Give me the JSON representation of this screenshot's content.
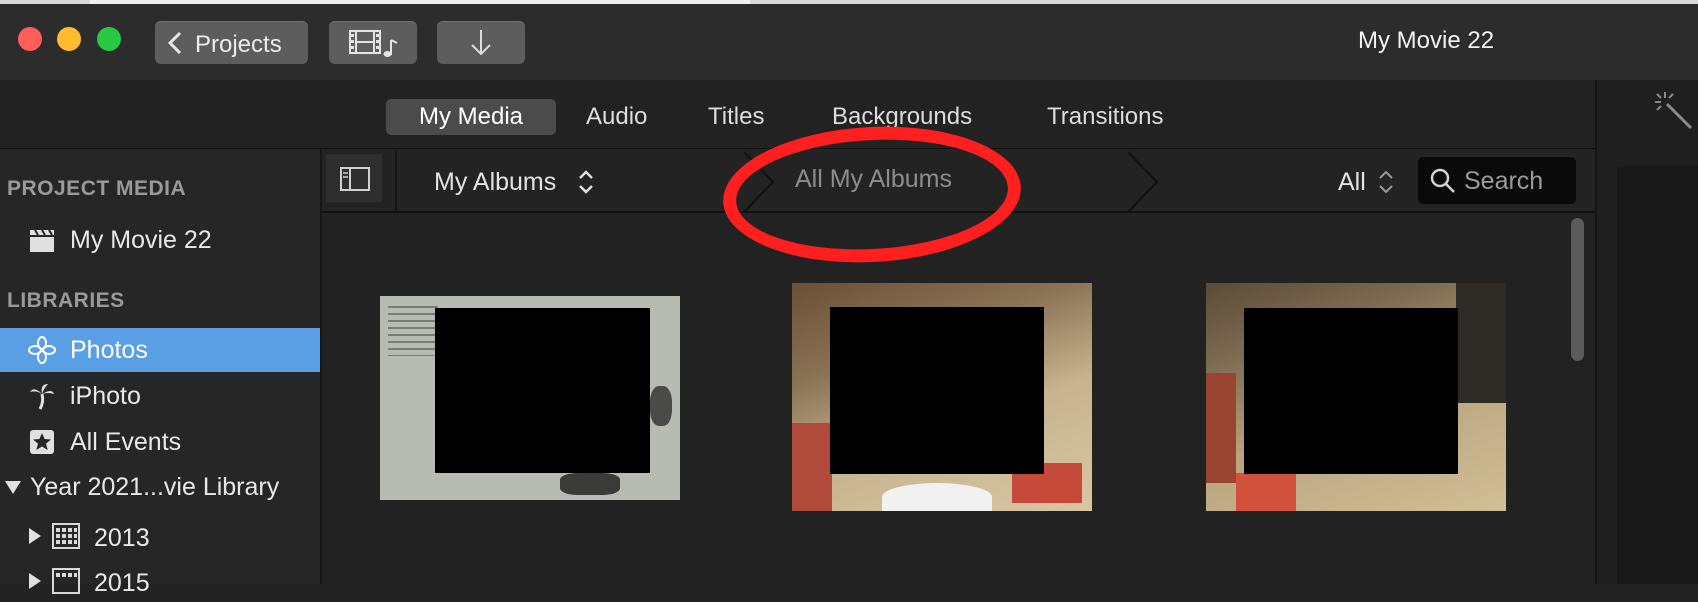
{
  "window": {
    "title": "My Movie 22",
    "projects_button": "Projects"
  },
  "tabs": [
    {
      "label": "My Media",
      "active": true
    },
    {
      "label": "Audio",
      "active": false
    },
    {
      "label": "Titles",
      "active": false
    },
    {
      "label": "Backgrounds",
      "active": false
    },
    {
      "label": "Transitions",
      "active": false
    }
  ],
  "sidebar": {
    "project_media_header": "PROJECT MEDIA",
    "project_item": "My Movie 22",
    "libraries_header": "LIBRARIES",
    "libraries": [
      {
        "label": "Photos",
        "icon": "photos-flower-icon",
        "selected": true
      },
      {
        "label": "iPhoto",
        "icon": "palm-tree-icon",
        "selected": false
      },
      {
        "label": "All Events",
        "icon": "star-icon",
        "selected": false
      }
    ],
    "library_group": "Year 2021...vie Library",
    "years": [
      "2013",
      "2015"
    ]
  },
  "browser": {
    "album_selector": "My Albums",
    "breadcrumb": "All My Albums",
    "filter": "All",
    "search_placeholder": "Search"
  },
  "colors": {
    "selection": "#5a9ee4",
    "annotation": "#ff1f1f"
  }
}
